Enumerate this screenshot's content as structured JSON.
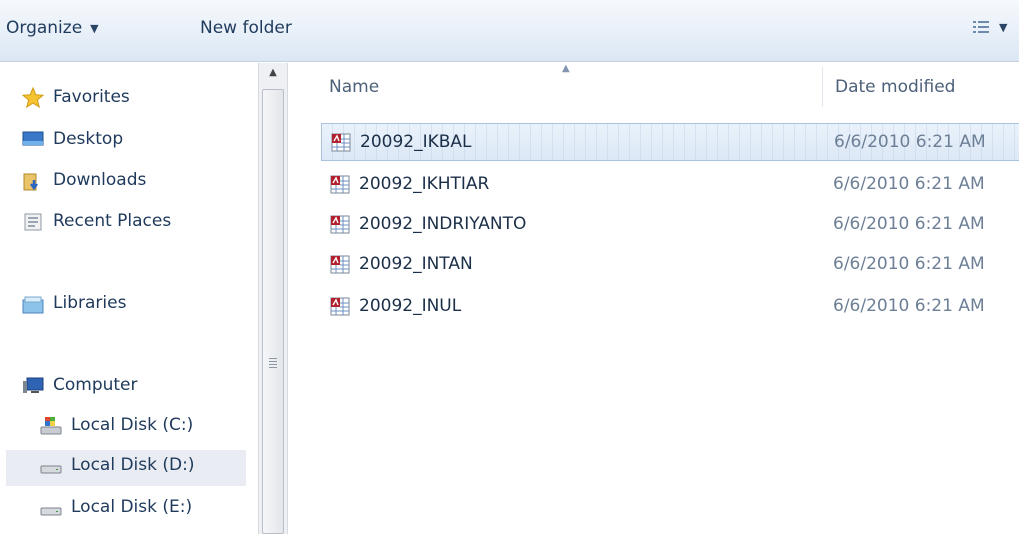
{
  "toolbar": {
    "organize_label": "Organize",
    "new_folder_label": "New folder"
  },
  "nav": {
    "favorites": "Favorites",
    "desktop": "Desktop",
    "downloads": "Downloads",
    "recent_places": "Recent Places",
    "libraries": "Libraries",
    "computer": "Computer",
    "disk_c": "Local Disk (C:)",
    "disk_d": "Local Disk (D:)",
    "disk_e": "Local Disk (E:)"
  },
  "columns": {
    "name": "Name",
    "date_modified": "Date modified"
  },
  "files": [
    {
      "name": "20092_IKBAL",
      "date": "6/6/2010 6:21 AM"
    },
    {
      "name": "20092_IKHTIAR",
      "date": "6/6/2010 6:21 AM"
    },
    {
      "name": "20092_INDRIYANTO",
      "date": "6/6/2010 6:21 AM"
    },
    {
      "name": "20092_INTAN",
      "date": "6/6/2010 6:21 AM"
    },
    {
      "name": "20092_INUL",
      "date": "6/6/2010 6:21 AM"
    }
  ],
  "colors": {
    "toolbar_bg": "#dce7f4",
    "selection": "#dce8f6",
    "text": "#1e395b"
  }
}
